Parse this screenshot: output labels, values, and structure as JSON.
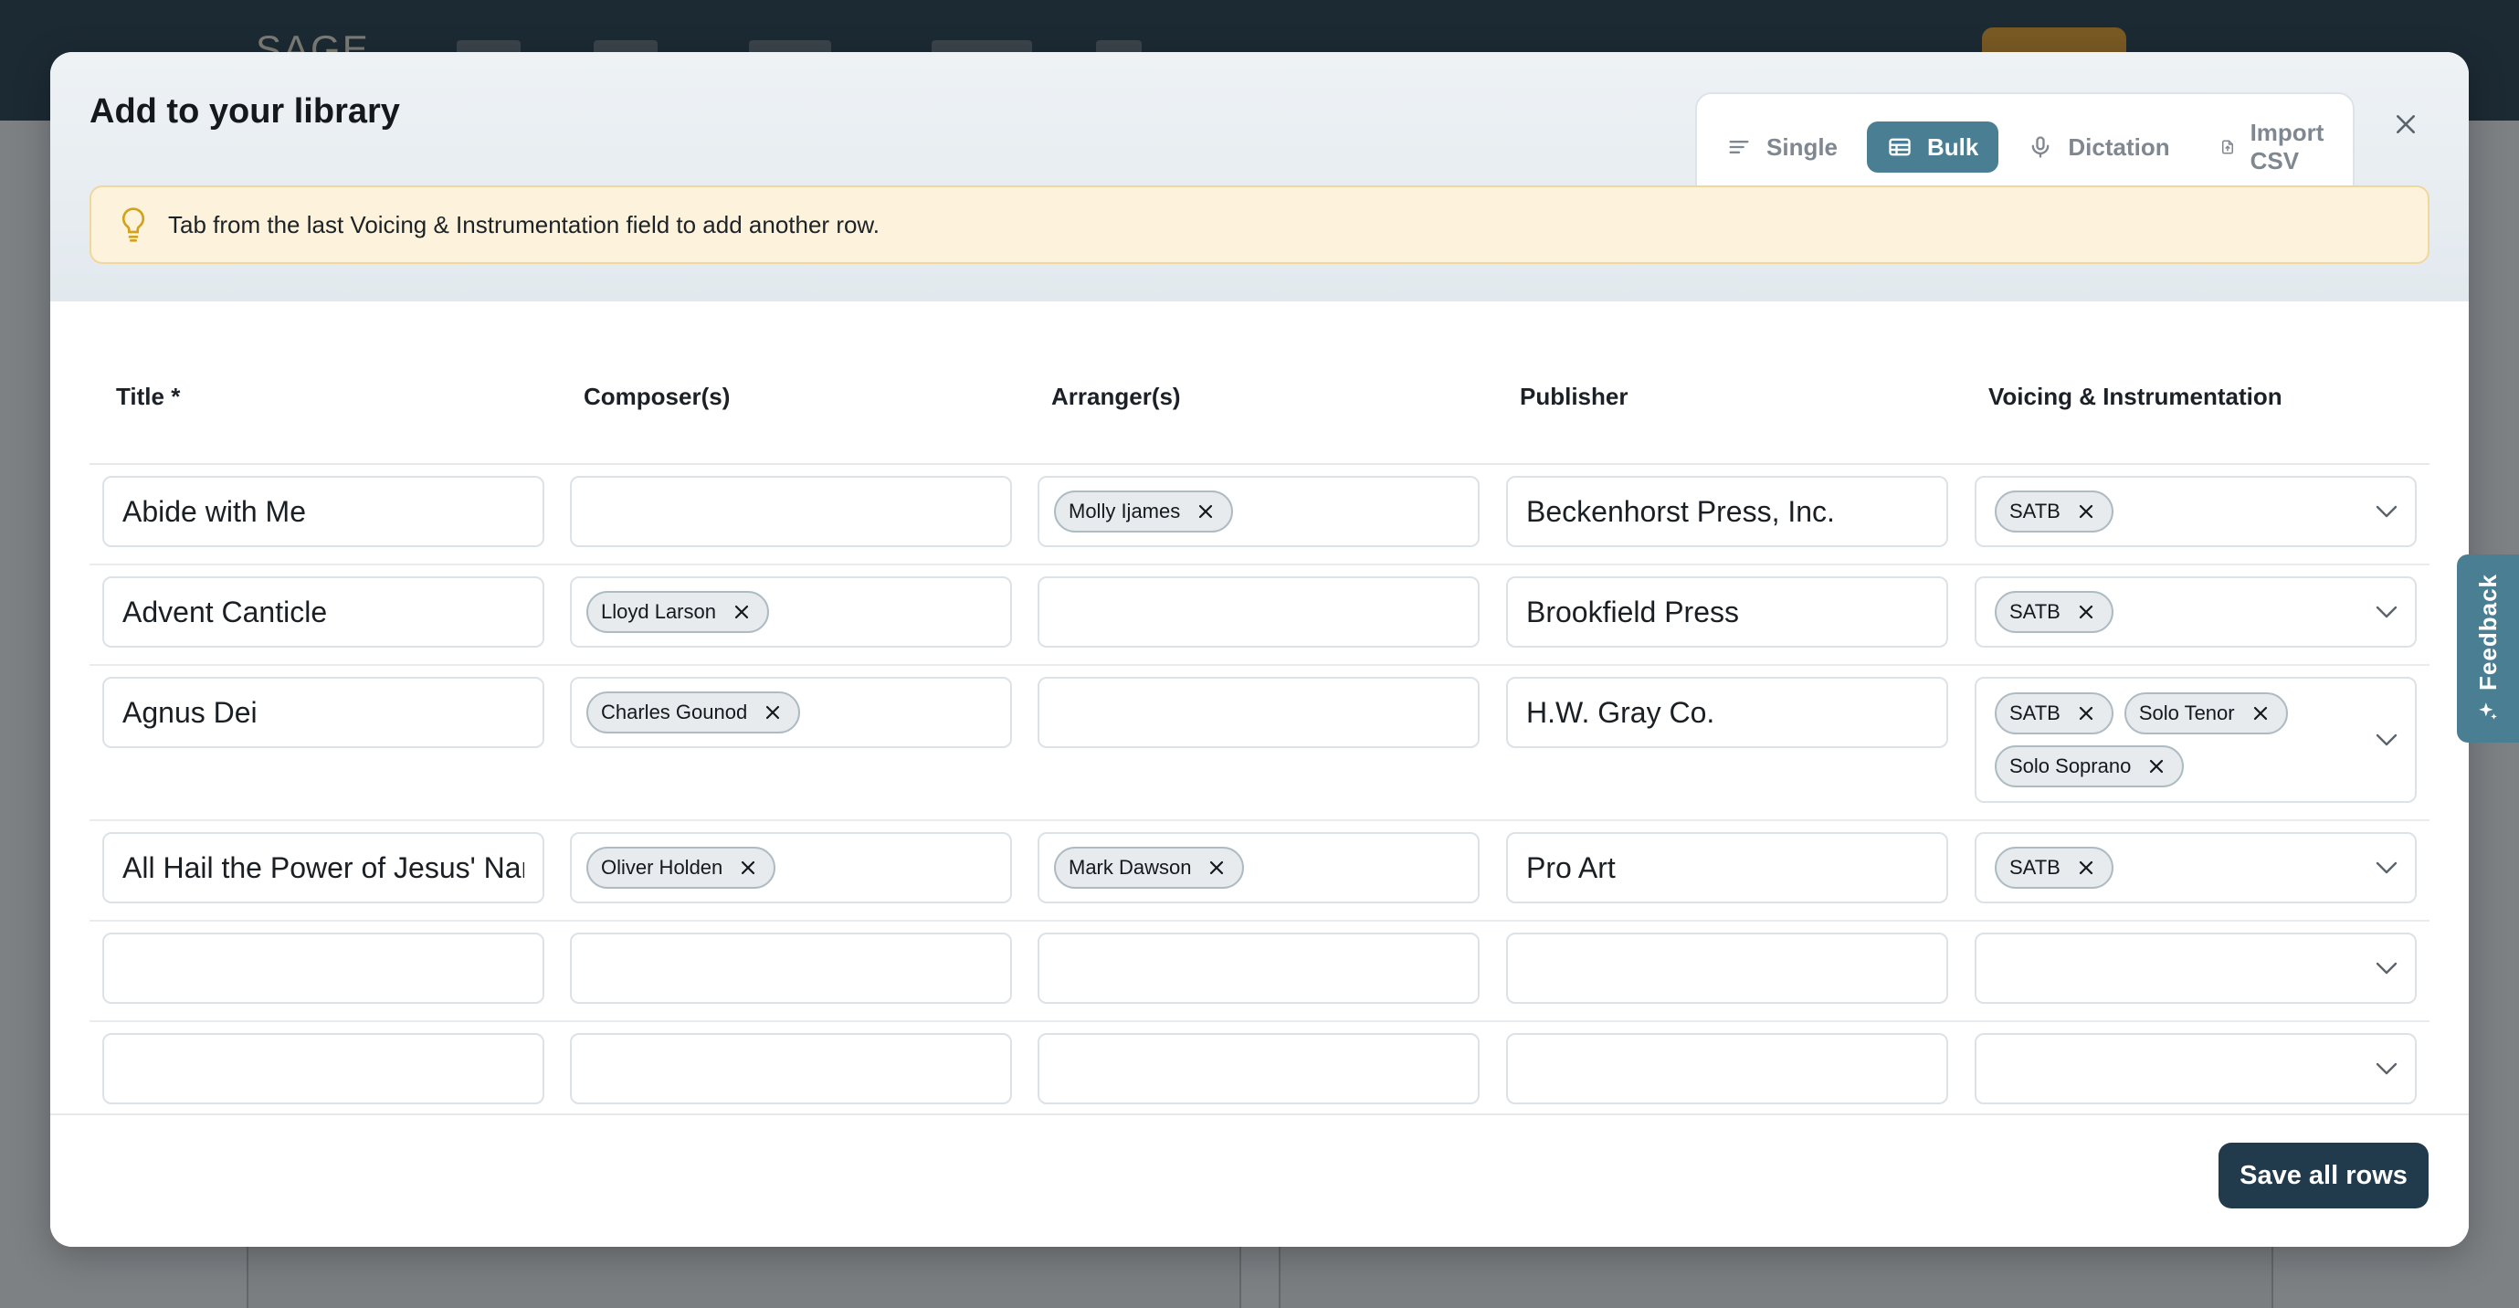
{
  "background": {
    "logo": "SAGE"
  },
  "modal": {
    "title": "Add to your library",
    "modes": [
      {
        "label": "Single",
        "icon": "lines-icon",
        "active": false
      },
      {
        "label": "Bulk",
        "icon": "table-icon",
        "active": true
      },
      {
        "label": "Dictation",
        "icon": "microphone-icon",
        "active": false
      },
      {
        "label": "Import CSV",
        "icon": "file-upload-icon",
        "active": false
      }
    ],
    "tip": "Tab from the last Voicing & Instrumentation field to add another row.",
    "save_label": "Save all rows"
  },
  "table": {
    "columns": [
      "Title *",
      "Composer(s)",
      "Arranger(s)",
      "Publisher",
      "Voicing & Instrumentation"
    ],
    "rows": [
      {
        "title": "Abide with Me",
        "composers": [],
        "arrangers": [
          "Molly Ijames"
        ],
        "publisher": "Beckenhorst Press, Inc.",
        "voicing": [
          "SATB"
        ]
      },
      {
        "title": "Advent Canticle",
        "composers": [
          "Lloyd Larson"
        ],
        "arrangers": [],
        "publisher": "Brookfield Press",
        "voicing": [
          "SATB"
        ]
      },
      {
        "title": "Agnus Dei",
        "composers": [
          "Charles Gounod"
        ],
        "arrangers": [],
        "publisher": "H.W. Gray Co.",
        "voicing": [
          "SATB",
          "Solo Tenor",
          "Solo Soprano"
        ]
      },
      {
        "title": "All Hail the Power of Jesus' Name",
        "composers": [
          "Oliver Holden"
        ],
        "arrangers": [
          "Mark Dawson"
        ],
        "publisher": "Pro Art",
        "voicing": [
          "SATB"
        ]
      },
      {
        "title": "",
        "composers": [],
        "arrangers": [],
        "publisher": "",
        "voicing": []
      },
      {
        "title": "",
        "composers": [],
        "arrangers": [],
        "publisher": "",
        "voicing": []
      }
    ]
  },
  "feedback": {
    "label": "Feedback"
  },
  "colors": {
    "accent": "#4a7f93",
    "primary_dark": "#213a4c",
    "tip_background": "#fdf3dc",
    "tip_border": "#f0d79b"
  }
}
